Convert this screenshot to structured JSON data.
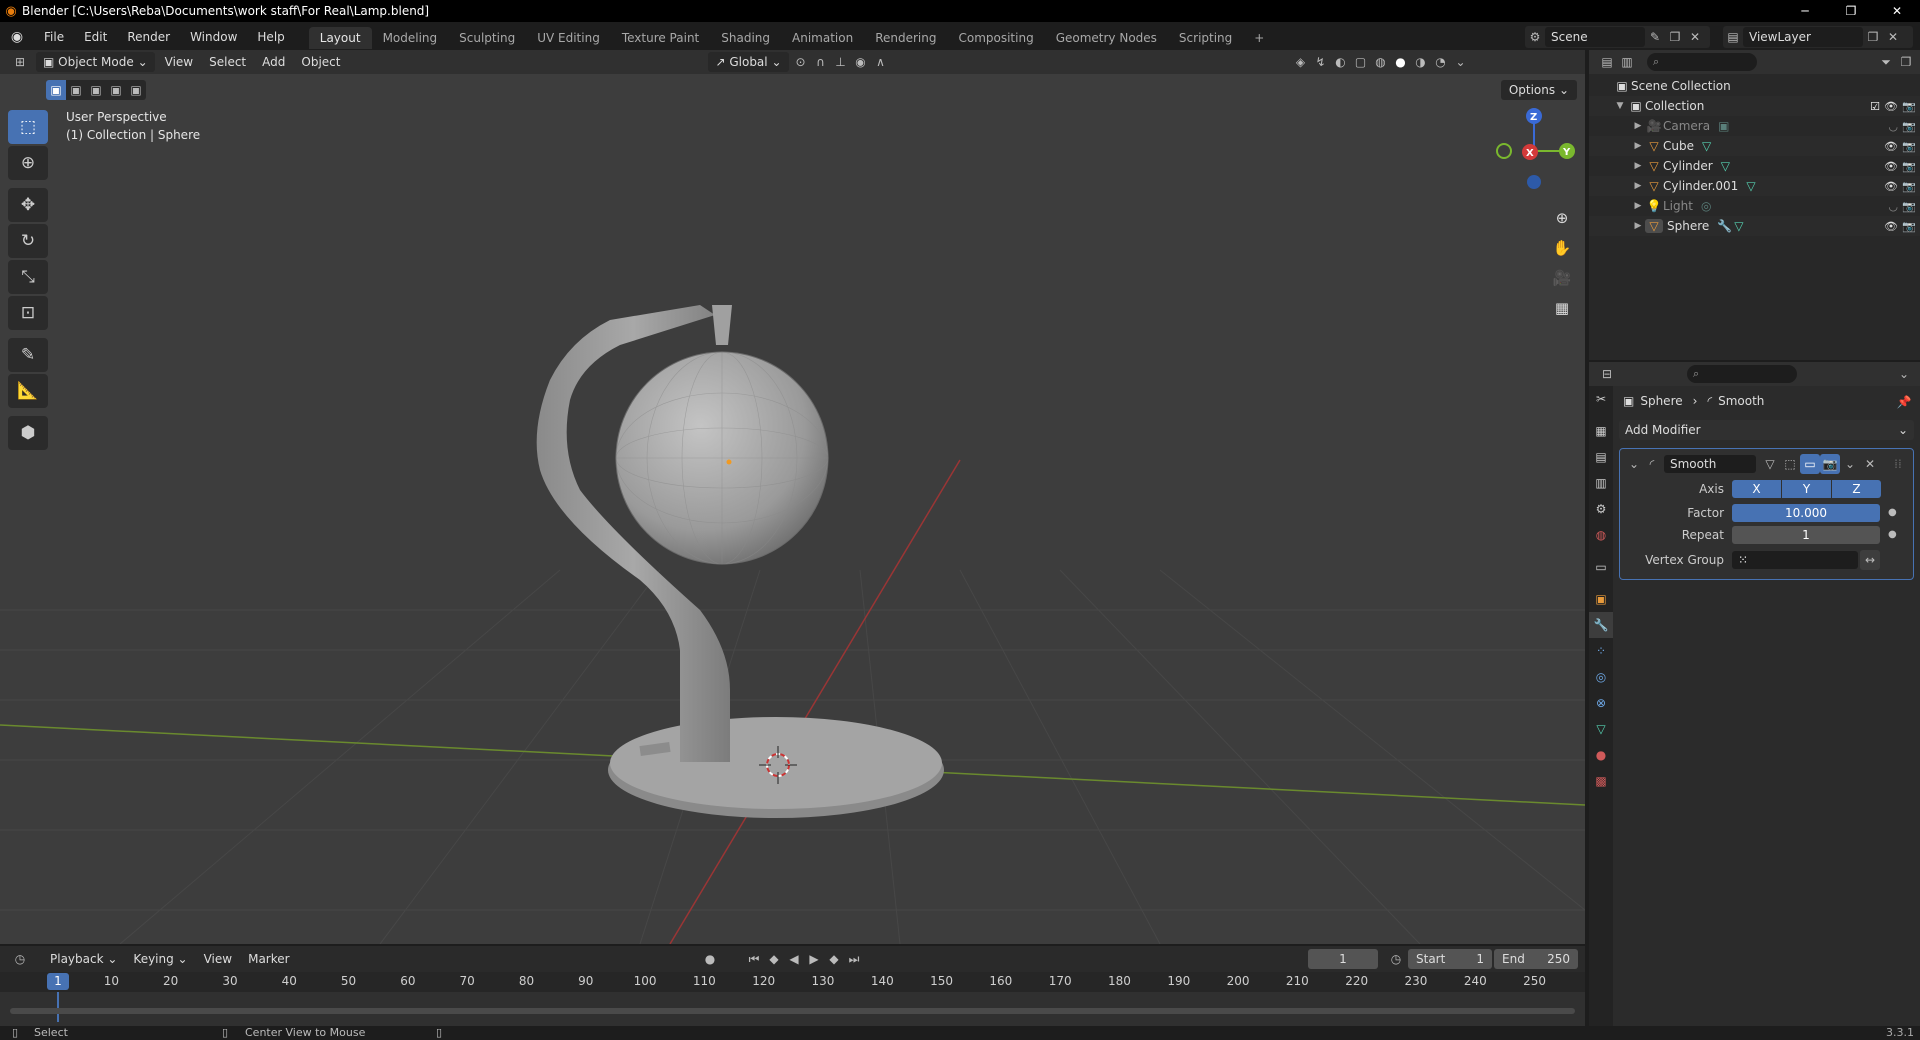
{
  "window": {
    "title": "Blender [C:\\Users\\Reba\\Documents\\work staff\\For Real\\Lamp.blend]"
  },
  "menu": [
    "File",
    "Edit",
    "Render",
    "Window",
    "Help"
  ],
  "workspaces": [
    "Layout",
    "Modeling",
    "Sculpting",
    "UV Editing",
    "Texture Paint",
    "Shading",
    "Animation",
    "Rendering",
    "Compositing",
    "Geometry Nodes",
    "Scripting"
  ],
  "active_workspace": "Layout",
  "scene": {
    "name": "Scene",
    "view_layer": "ViewLayer"
  },
  "viewport": {
    "mode": "Object Mode",
    "menus": [
      "View",
      "Select",
      "Add",
      "Object"
    ],
    "transform_orientation": "Global",
    "options_label": "Options",
    "info_line1": "User Perspective",
    "info_line2": "(1) Collection | Sphere",
    "gizmo": {
      "z": "Z",
      "x": "X",
      "y": "Y"
    }
  },
  "outliner": {
    "root": "Scene Collection",
    "collection": "Collection",
    "items": [
      {
        "name": "Camera",
        "dim": true
      },
      {
        "name": "Cube",
        "dim": false
      },
      {
        "name": "Cylinder",
        "dim": false
      },
      {
        "name": "Cylinder.001",
        "dim": false
      },
      {
        "name": "Light",
        "dim": true
      },
      {
        "name": "Sphere",
        "dim": false
      }
    ]
  },
  "properties": {
    "breadcrumb_object": "Sphere",
    "breadcrumb_modifier": "Smooth",
    "add_modifier_label": "Add Modifier",
    "modifier": {
      "name": "Smooth",
      "axis_label": "Axis",
      "axis_x": "X",
      "axis_y": "Y",
      "axis_z": "Z",
      "factor_label": "Factor",
      "factor_value": "10.000",
      "repeat_label": "Repeat",
      "repeat_value": "1",
      "vertex_group_label": "Vertex Group"
    }
  },
  "timeline": {
    "menus": [
      "Playback",
      "Keying",
      "View",
      "Marker"
    ],
    "current_frame": "1",
    "start_label": "Start",
    "start_value": "1",
    "end_label": "End",
    "end_value": "250",
    "ticks": [
      "10",
      "20",
      "30",
      "40",
      "50",
      "60",
      "70",
      "80",
      "90",
      "100",
      "110",
      "120",
      "130",
      "140",
      "150",
      "160",
      "170",
      "180",
      "190",
      "200",
      "210",
      "220",
      "230",
      "240",
      "250"
    ]
  },
  "statusbar": {
    "left": "Select",
    "middle": "Center View to Mouse",
    "version": "3.3.1"
  },
  "colors": {
    "accent": "#4772b3",
    "viewport_bg": "#3d3d3d",
    "mesh": "#9a9a9a"
  }
}
